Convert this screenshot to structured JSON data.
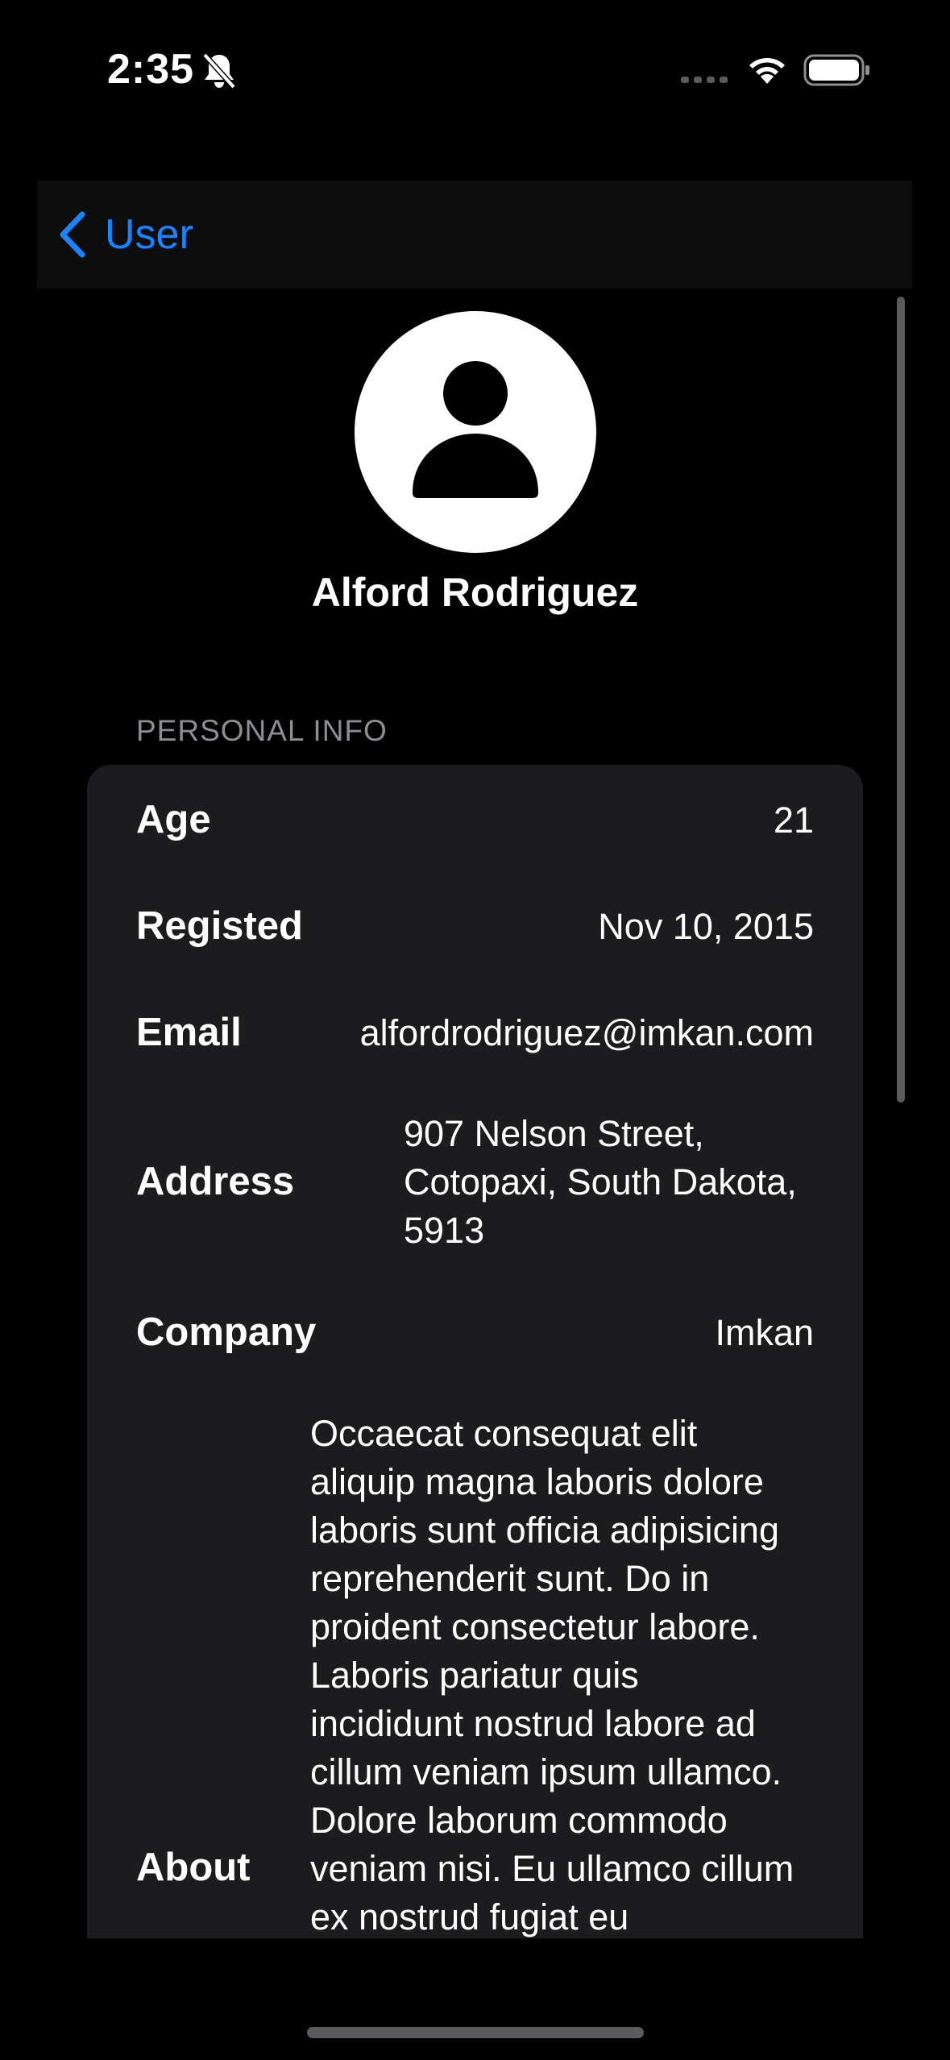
{
  "status_bar": {
    "time": "2:35",
    "icons": [
      "bell-slash-icon",
      "signal-icon",
      "wifi-icon",
      "battery-icon"
    ]
  },
  "nav": {
    "back_label": "User",
    "back_icon": "chevron-left-icon"
  },
  "profile": {
    "avatar_icon": "person-icon",
    "name": "Alford Rodriguez"
  },
  "personal_info": {
    "header": "PERSONAL INFO",
    "age": {
      "label": "Age",
      "value": "21"
    },
    "registered": {
      "label": "Registed",
      "value": "Nov 10, 2015"
    },
    "email": {
      "label": "Email",
      "value": "alfordrodriguez@imkan.com"
    },
    "address": {
      "label": "Address",
      "lines": [
        "907 Nelson Street,",
        "Cotopaxi, South Dakota,",
        "5913"
      ]
    },
    "company": {
      "label": "Company",
      "value": "Imkan"
    },
    "about": {
      "label": "About",
      "lines": [
        "Occaecat consequat elit",
        "aliquip magna laboris dolore",
        "laboris sunt officia adipisicing",
        "reprehenderit sunt. Do in",
        "proident consectetur labore.",
        "Laboris pariatur quis",
        "incididunt nostrud labore ad",
        "cillum veniam ipsum ullamco.",
        "Dolore laborum commodo",
        "veniam nisi. Eu ullamco cillum",
        "ex nostrud fugiat eu"
      ]
    }
  },
  "colors": {
    "accent": "#1a84ff",
    "background": "#000000",
    "card": "#1c1c1e",
    "secondary_text": "#8d8d93"
  }
}
